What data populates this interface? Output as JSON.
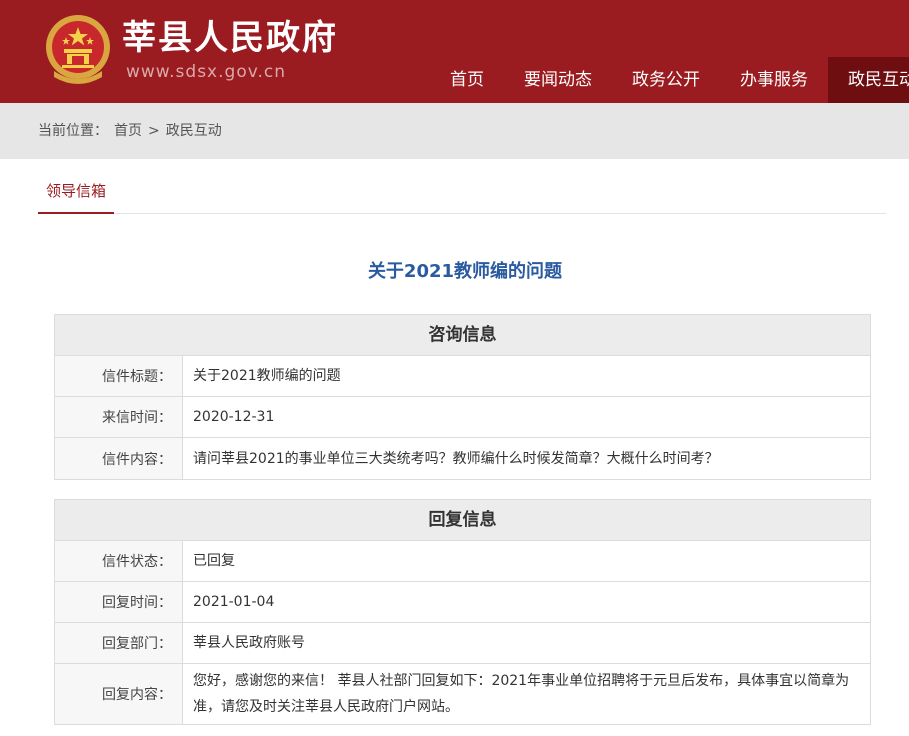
{
  "header": {
    "site_title": "莘县人民政府",
    "site_url": "www.sdsx.gov.cn",
    "nav": [
      "首页",
      "要闻动态",
      "政务公开",
      "办事服务",
      "政民互动"
    ],
    "brand_color": "#9b1c20"
  },
  "breadcrumb": {
    "prefix": "当前位置：",
    "home": "首页",
    "separator": ">",
    "current": "政民互动"
  },
  "tabs": [
    "领导信箱"
  ],
  "page_title": "关于2021教师编的问题",
  "consult": {
    "heading": "咨询信息",
    "rows": [
      {
        "label": "信件标题：",
        "value": "关于2021教师编的问题"
      },
      {
        "label": "来信时间：",
        "value": "2020-12-31"
      },
      {
        "label": "信件内容：",
        "value": "请问莘县2021的事业单位三大类统考吗？教师编什么时候发简章？大概什么时间考？"
      }
    ]
  },
  "reply": {
    "heading": "回复信息",
    "rows": [
      {
        "label": "信件状态：",
        "value": "已回复"
      },
      {
        "label": "回复时间：",
        "value": "2021-01-04"
      },
      {
        "label": "回复部门：",
        "value": "莘县人民政府账号"
      },
      {
        "label": "回复内容：",
        "value": "您好，感谢您的来信！ 莘县人社部门回复如下：2021年事业单位招聘将于元旦后发布，具体事宜以简章为准，请您及时关注莘县人民政府门户网站。"
      }
    ]
  }
}
